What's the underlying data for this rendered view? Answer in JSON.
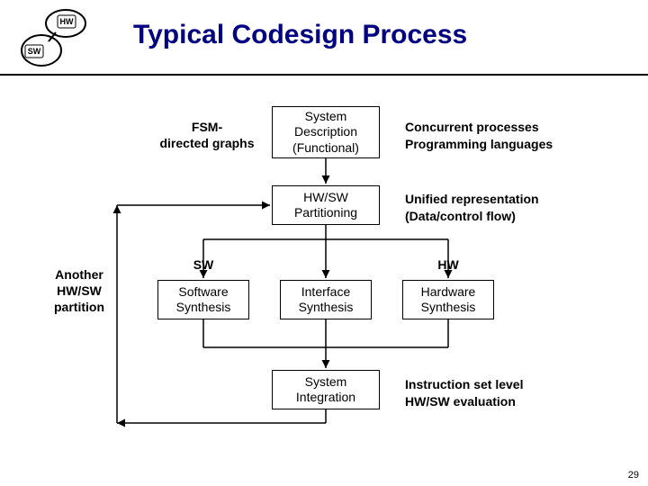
{
  "logo": {
    "top_label": "HW",
    "bottom_label": "SW"
  },
  "title": "Typical Codesign Process",
  "left_label": "FSM-\ndirected graphs",
  "box_sysdesc": "System\nDescription\n(Functional)",
  "right_sysdesc": "Concurrent processes\nProgramming languages",
  "box_partition": "HW/SW\nPartitioning",
  "right_partition": "Unified representation\n(Data/control flow)",
  "feedback_label": "Another\nHW/SW\npartition",
  "sw_label": "SW",
  "hw_label": "HW",
  "box_sw_synth": "Software\nSynthesis",
  "box_if_synth": "Interface\nSynthesis",
  "box_hw_synth": "Hardware\nSynthesis",
  "box_sysint": "System\nIntegration",
  "right_sysint": "Instruction set level\nHW/SW evaluation",
  "slide_number": "29",
  "chart_data": {
    "type": "table",
    "title": "Typical Codesign Process flowchart",
    "nodes": [
      {
        "id": "sysdesc",
        "label": "System Description (Functional)",
        "annotations": [
          "FSM-directed graphs",
          "Concurrent processes / Programming languages"
        ]
      },
      {
        "id": "partition",
        "label": "HW/SW Partitioning",
        "annotations": [
          "Unified representation (Data/control flow)"
        ]
      },
      {
        "id": "sw",
        "label": "Software Synthesis",
        "group": "SW"
      },
      {
        "id": "if",
        "label": "Interface Synthesis"
      },
      {
        "id": "hw",
        "label": "Hardware Synthesis",
        "group": "HW"
      },
      {
        "id": "sysint",
        "label": "System Integration",
        "annotations": [
          "Instruction set level HW/SW evaluation"
        ]
      }
    ],
    "edges": [
      {
        "from": "sysdesc",
        "to": "partition"
      },
      {
        "from": "partition",
        "to": "sw"
      },
      {
        "from": "partition",
        "to": "if"
      },
      {
        "from": "partition",
        "to": "hw"
      },
      {
        "from": "sw",
        "to": "sysint"
      },
      {
        "from": "if",
        "to": "sysint"
      },
      {
        "from": "hw",
        "to": "sysint"
      },
      {
        "from": "sysint",
        "to": "partition",
        "label": "Another HW/SW partition",
        "kind": "feedback"
      }
    ]
  }
}
